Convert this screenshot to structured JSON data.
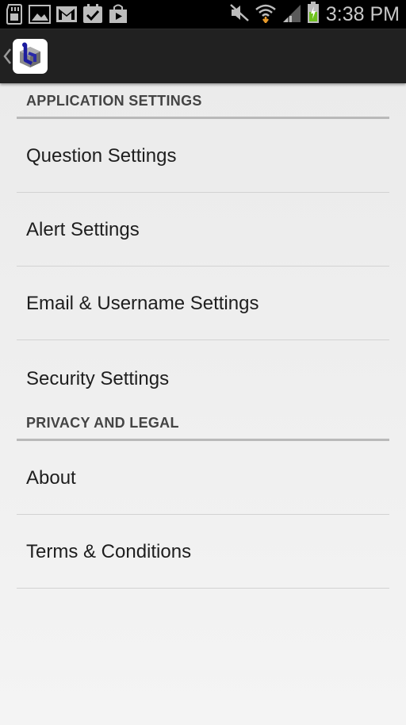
{
  "status_bar": {
    "time": "3:38 PM",
    "left_icons": [
      "sd-card-icon",
      "image-icon",
      "gmail-icon",
      "task-check-icon",
      "play-store-icon"
    ],
    "right_icons": [
      "mute-icon",
      "wifi-icon",
      "signal-icon",
      "battery-charging-icon"
    ],
    "battery_color": "#6ec01e"
  },
  "action_bar": {
    "background": "#212121",
    "logo_icon": "app-logo-icon"
  },
  "sections": [
    {
      "header": "APPLICATION SETTINGS",
      "items": [
        {
          "label": "Question Settings"
        },
        {
          "label": "Alert Settings"
        },
        {
          "label": "Email & Username Settings"
        },
        {
          "label": "Security Settings"
        }
      ]
    },
    {
      "header": "PRIVACY AND LEGAL",
      "items": [
        {
          "label": "About"
        },
        {
          "label": "Terms & Conditions"
        }
      ]
    }
  ]
}
